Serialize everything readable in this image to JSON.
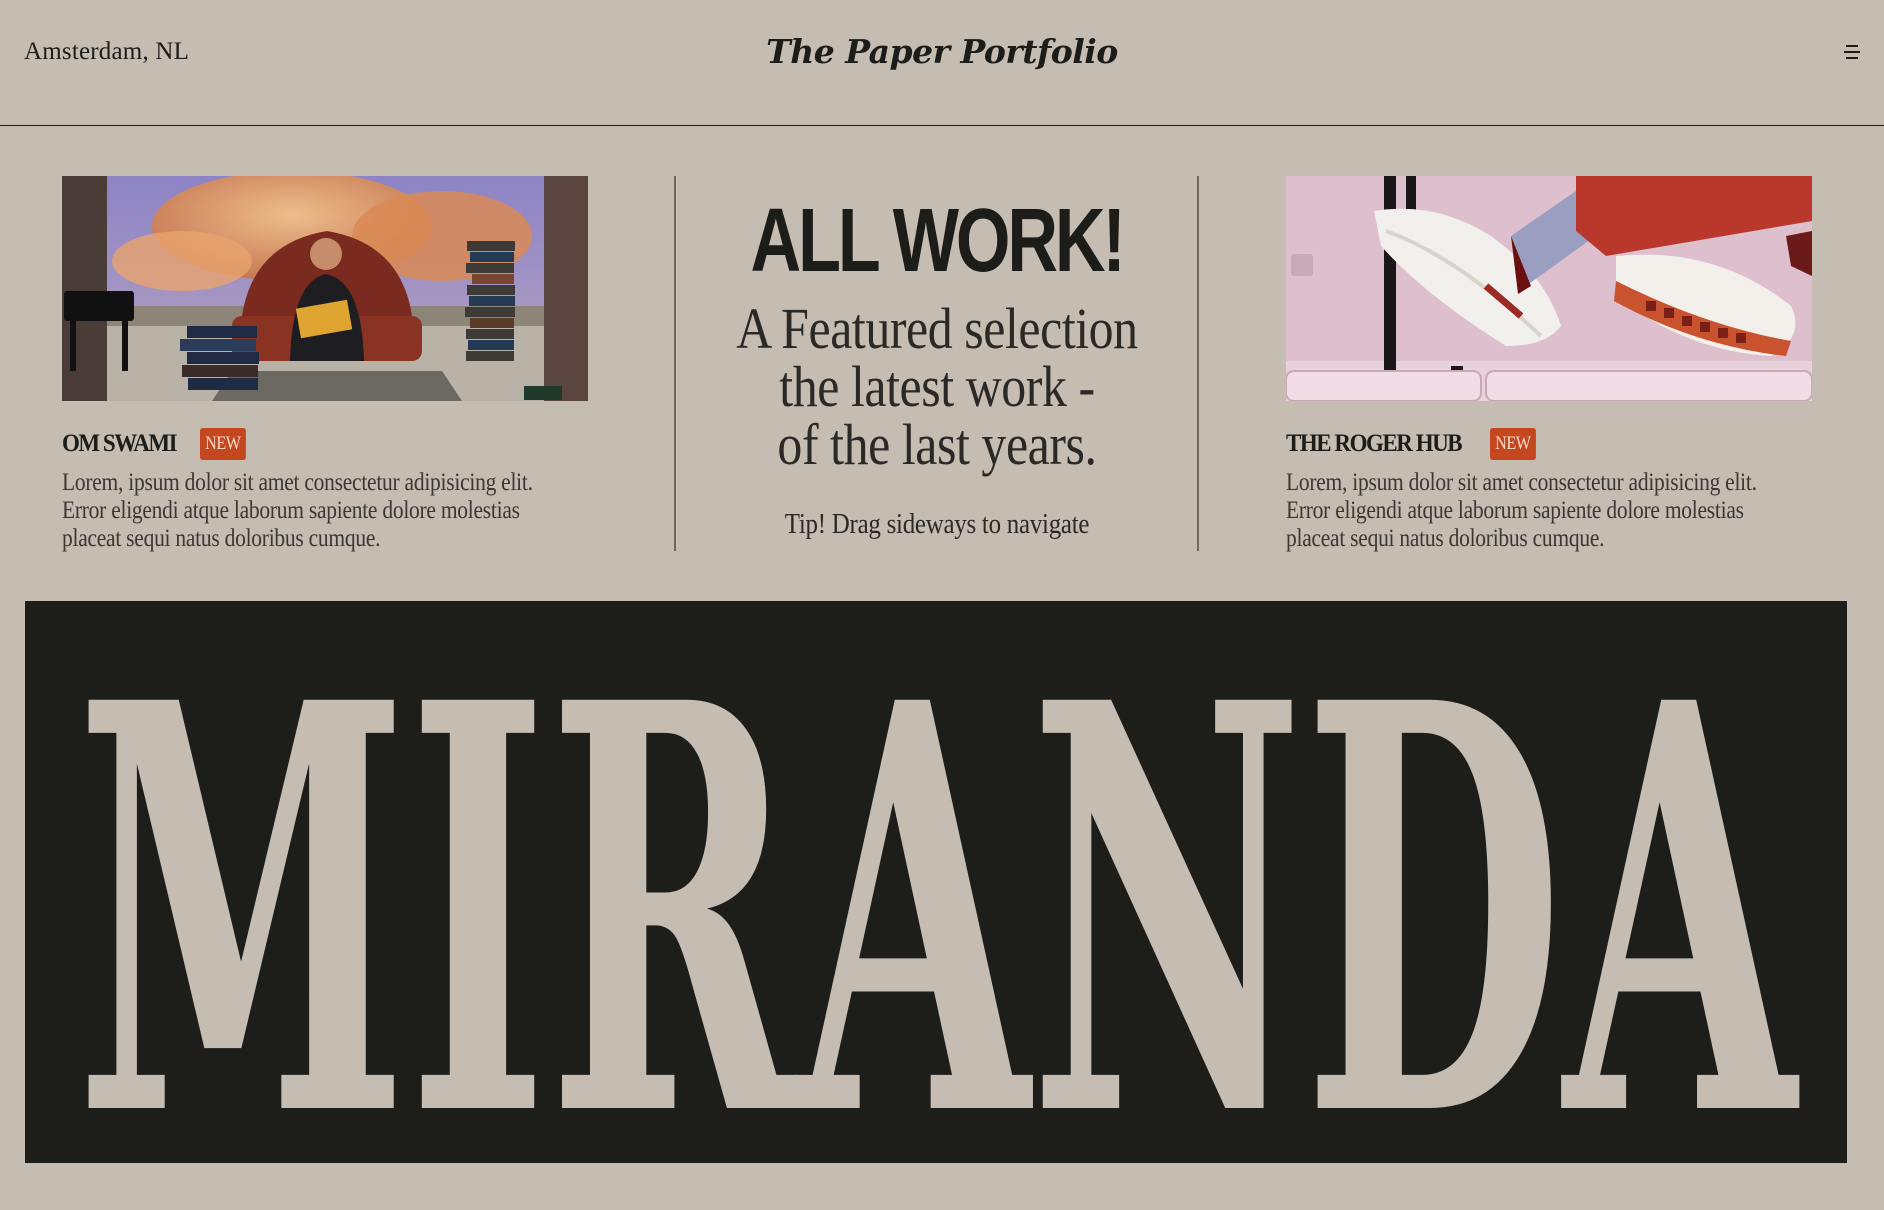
{
  "header": {
    "location": "Amsterdam, NL",
    "brand": "The Paper Portfolio",
    "menu_icon": "hamburger-menu-icon"
  },
  "projects": [
    {
      "name": "OM SWAMI",
      "badge": "NEW",
      "description": "Lorem, ipsum dolor sit amet consectetur adipisicing elit. Error eligendi atque laborum sapiente dolore molestias placeat sequi natus doloribus cumque."
    },
    {
      "name": "THE ROGER HUB",
      "badge": "NEW",
      "description": "Lorem, ipsum dolor sit amet consectetur adipisicing elit. Error eligendi atque laborum sapiente dolore molestias placeat sequi natus doloribus cumque."
    }
  ],
  "featured": {
    "heading": "ALL WORK!",
    "tagline_lines": [
      "A Featured selection",
      "the latest work -",
      "of the last years."
    ],
    "tip": "Tip! Drag sideways to navigate"
  },
  "banner": {
    "text": "MIRANDA"
  },
  "colors": {
    "background": "#c5bcb2",
    "ink": "#1c1c19",
    "badge": "#c4471f"
  }
}
